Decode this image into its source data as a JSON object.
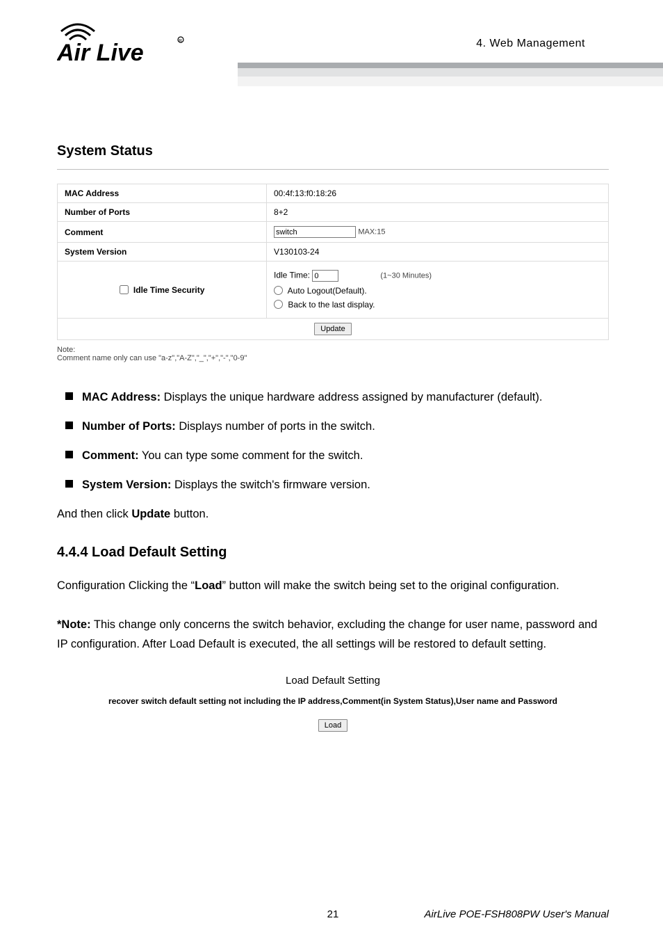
{
  "header": {
    "section_label": "4.  Web Management"
  },
  "system_status": {
    "title": "System Status",
    "rows": {
      "mac_label": "MAC Address",
      "mac_value": "00:4f:13:f0:18:26",
      "ports_label": "Number of Ports",
      "ports_value": "8+2",
      "comment_label": "Comment",
      "comment_input_value": "switch",
      "comment_max": "MAX:15",
      "version_label": "System Version",
      "version_value": "V130103-24",
      "idle_checkbox_label": "Idle Time Security",
      "idle_time_label": "Idle Time:",
      "idle_time_value": "0",
      "idle_time_range": "(1~30 Minutes)",
      "radio_auto_logout": "Auto Logout(Default).",
      "radio_back_last": "Back to the last display.",
      "update_button": "Update"
    },
    "note_title": "Note:",
    "note_body": "Comment name only can use \"a-z\",\"A-Z\",\"_\",\"+\",\"-\",\"0-9\""
  },
  "descriptions": [
    {
      "term": "MAC Address:",
      "text": " Displays the unique hardware address assigned by manufacturer (default)."
    },
    {
      "term": "Number of Ports:",
      "text": " Displays number of ports in the switch."
    },
    {
      "term": "Comment:",
      "text": " You can type some comment for the switch."
    },
    {
      "term": "System Version:",
      "text": " Displays the switch's firmware version."
    }
  ],
  "post_list_text_pre": "And then click ",
  "post_list_text_bold": "Update",
  "post_list_text_post": " button.",
  "load_default": {
    "heading": "4.4.4 Load Default Setting",
    "para1_pre": "Configuration Clicking the “",
    "para1_bold": "Load",
    "para1_post": "” button will make the switch being set to the original configuration.",
    "note_label": "*Note:",
    "note_text": " This change only concerns the switch behavior, excluding the change for user name, password and IP configuration. After Load Default is executed, the all settings will be restored to default setting.",
    "panel_title": "Load Default Setting",
    "panel_desc": "recover switch default setting not including the IP address,Comment(in System Status),User name and Password",
    "load_button": "Load"
  },
  "footer": {
    "page_number": "21",
    "manual_title": "AirLive POE-FSH808PW User's Manual"
  }
}
